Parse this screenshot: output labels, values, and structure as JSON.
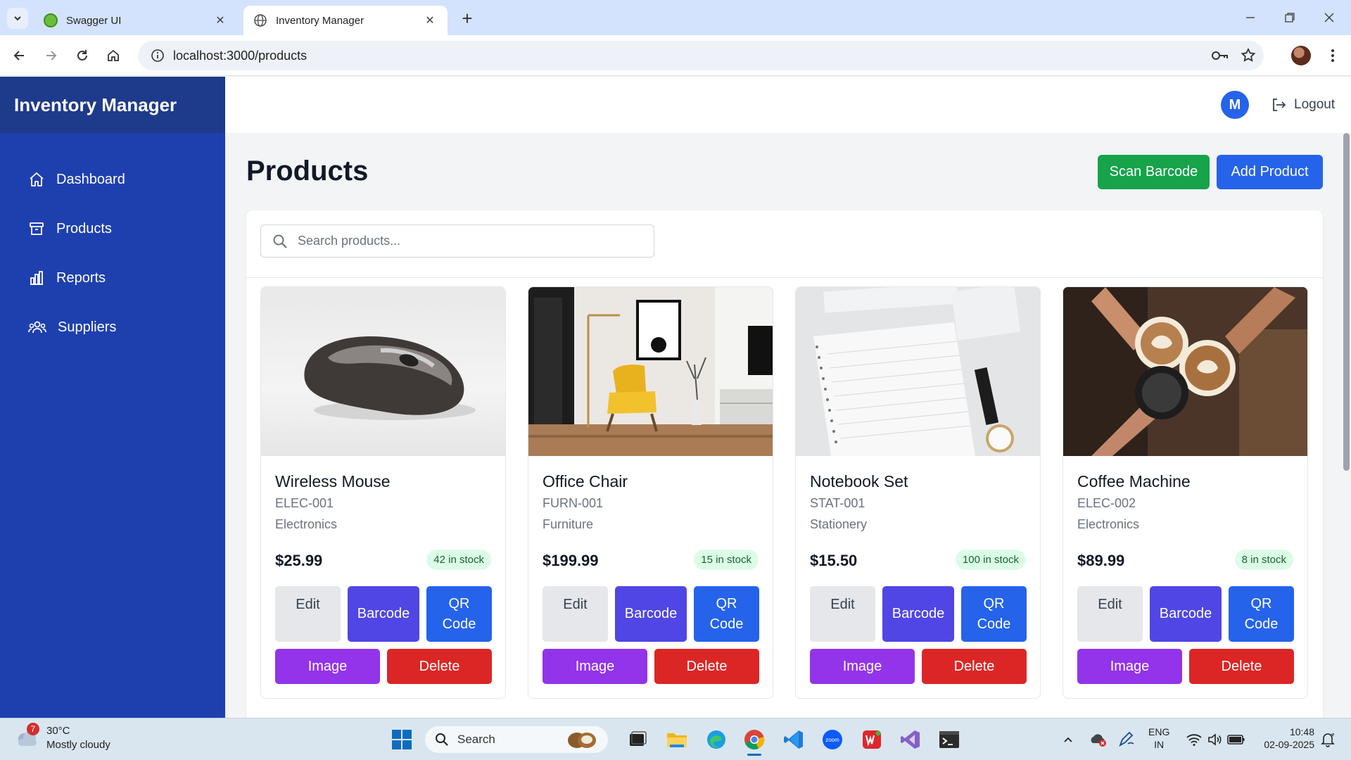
{
  "browser": {
    "tabs": [
      {
        "title": "Swagger UI",
        "active": false
      },
      {
        "title": "Inventory Manager",
        "active": true
      }
    ],
    "url": "localhost:3000/products"
  },
  "app": {
    "brand": "Inventory Manager",
    "nav": [
      {
        "label": "Dashboard",
        "icon": "home-icon"
      },
      {
        "label": "Products",
        "icon": "archive-box-icon"
      },
      {
        "label": "Reports",
        "icon": "bar-chart-icon"
      },
      {
        "label": "Suppliers",
        "icon": "users-icon"
      }
    ],
    "user_initial": "M",
    "logout_label": "Logout",
    "page_title": "Products",
    "scan_barcode_label": "Scan Barcode",
    "add_product_label": "Add Product",
    "search_placeholder": "Search products..."
  },
  "products": [
    {
      "name": "Wireless Mouse",
      "sku": "ELEC-001",
      "category": "Electronics",
      "price": "$25.99",
      "stock": "42 in stock",
      "image": "mouse"
    },
    {
      "name": "Office Chair",
      "sku": "FURN-001",
      "category": "Furniture",
      "price": "$199.99",
      "stock": "15 in stock",
      "image": "chair"
    },
    {
      "name": "Notebook Set",
      "sku": "STAT-001",
      "category": "Stationery",
      "price": "$15.50",
      "stock": "100 in stock",
      "image": "notebook"
    },
    {
      "name": "Coffee Machine",
      "sku": "ELEC-002",
      "category": "Electronics",
      "price": "$89.99",
      "stock": "8 in stock",
      "image": "coffee"
    }
  ],
  "card_buttons": {
    "edit": "Edit",
    "barcode": "Barcode",
    "qr": "QR Code",
    "image": "Image",
    "delete": "Delete"
  },
  "taskbar": {
    "weather_temp": "30°C",
    "weather_desc": "Mostly cloudy",
    "weather_badge": "7",
    "search_label": "Search",
    "lang_top": "ENG",
    "lang_bottom": "IN",
    "time": "10:48",
    "date": "02-09-2025"
  },
  "colors": {
    "sidebar": "#1e40af",
    "brand_bar": "#1e3a8a",
    "primary": "#2563eb",
    "success": "#16a34a",
    "indigo": "#4f46e5",
    "purple": "#9333ea",
    "danger": "#dc2626"
  }
}
